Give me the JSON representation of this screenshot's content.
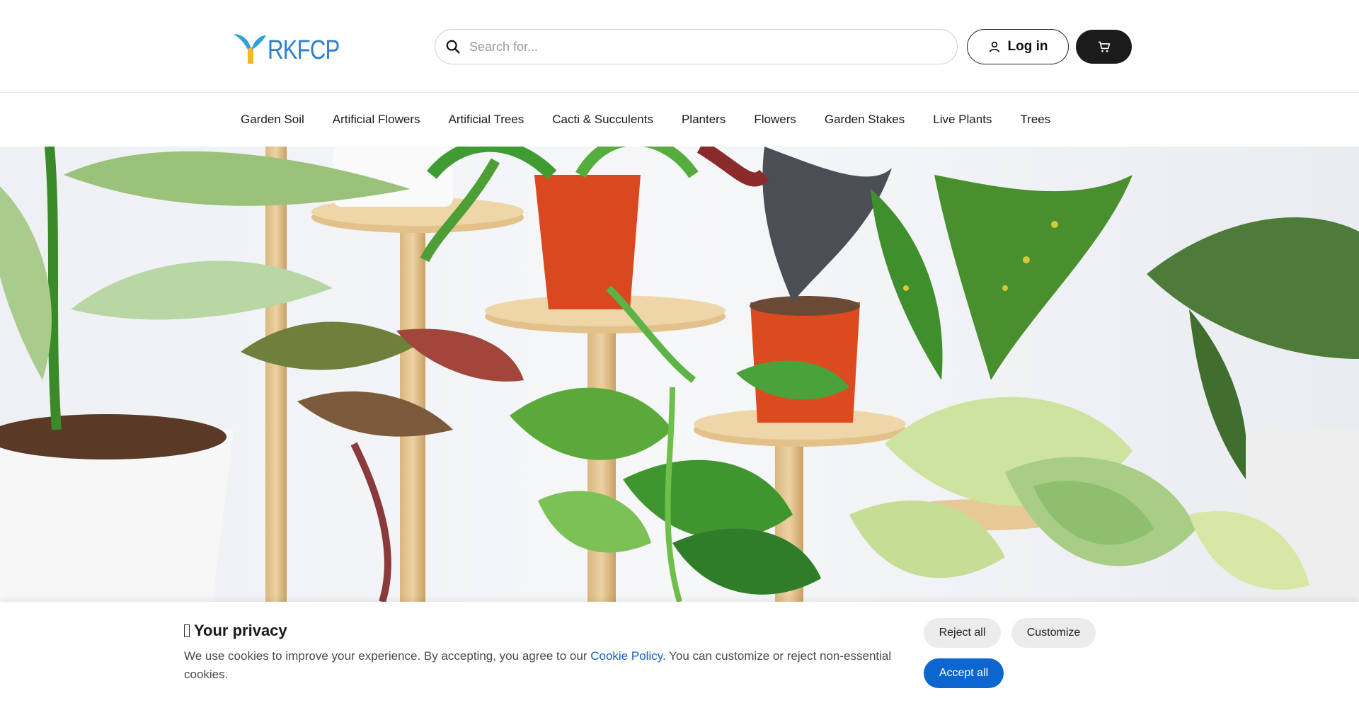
{
  "brand": {
    "name": "RKFCP",
    "logo_icon": "sprout-icon",
    "accent": "#2f7fce"
  },
  "search": {
    "placeholder": "Search for...",
    "value": "",
    "icon": "search-icon"
  },
  "header": {
    "login_label": "Log in",
    "login_icon": "user-icon",
    "cart_icon": "cart-icon"
  },
  "nav": {
    "items": [
      {
        "label": "Garden Soil"
      },
      {
        "label": "Artificial Flowers"
      },
      {
        "label": "Artificial Trees"
      },
      {
        "label": "Cacti & Succulents"
      },
      {
        "label": "Planters"
      },
      {
        "label": "Flowers"
      },
      {
        "label": "Garden Stakes"
      },
      {
        "label": "Live Plants"
      },
      {
        "label": "Trees"
      }
    ]
  },
  "hero": {
    "image_alt": "houseplants in pots on wooden plant stands"
  },
  "cookie": {
    "title": "Your privacy",
    "text_before": "We use cookies to improve your experience. By accepting, you agree to our ",
    "policy_link": "Cookie Policy",
    "text_after": ". You can customize or reject non-essential cookies.",
    "reject_label": "Reject all",
    "customize_label": "Customize",
    "accept_label": "Accept all",
    "accept_color": "#0b66d0"
  }
}
